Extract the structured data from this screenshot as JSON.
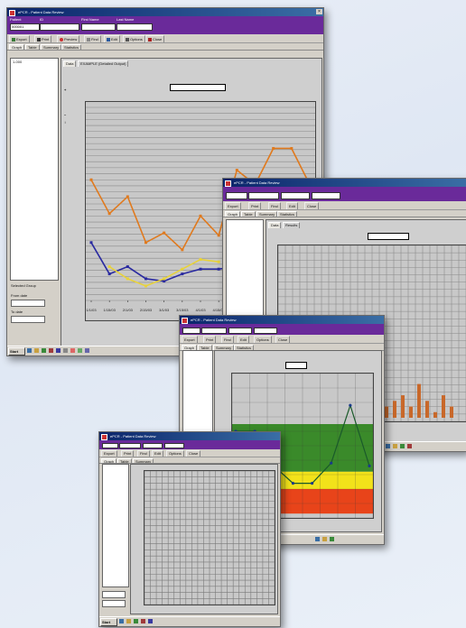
{
  "win1": {
    "title": "ePCR - Patient Data Review",
    "header_labels": [
      "Patient",
      "ID",
      "First Name",
      "Last Name"
    ],
    "patient_id": "000001",
    "toolbar": [
      "Export",
      "Print",
      "Preview",
      "Find",
      "Edit",
      "Options",
      "Close"
    ],
    "tabs": [
      "Graph",
      "Table",
      "Summary",
      "Statistics"
    ],
    "list_item": "1-000",
    "chart_tabs": [
      "Data",
      "EXAMPLE (Detailed Output)"
    ],
    "filters": {
      "section_label": "Selected Group",
      "from_label": "From date",
      "to_label": "To date"
    },
    "chart_data": {
      "type": "line",
      "x": [
        "1/1/03",
        "1/15/03",
        "2/1/03",
        "2/15/03",
        "3/1/03",
        "3/15/03",
        "4/1/03",
        "4/15/03",
        "5/1/03",
        "5/15/03",
        "6/1/03",
        "6/15/03",
        "7/1/03"
      ],
      "series": [
        {
          "color": "#e07a1e",
          "values": [
            120,
            106,
            113,
            94,
            98,
            91,
            105,
            97,
            124,
            118,
            133,
            133,
            118
          ]
        },
        {
          "color": "#2a2aa0",
          "values": [
            94,
            81,
            84,
            79,
            78,
            81,
            83,
            83,
            84,
            84,
            83,
            84,
            84
          ]
        },
        {
          "color": "#e8d23a",
          "values": [
            null,
            84,
            79,
            76,
            79,
            83,
            87,
            86,
            null,
            null,
            null,
            null,
            null
          ]
        }
      ],
      "ylim": [
        70,
        150
      ],
      "grid": true
    }
  },
  "win2": {
    "title": "ePCR - Patient Data Review",
    "toolbar": [
      "Export",
      "Print",
      "Find",
      "Edit",
      "Close"
    ],
    "tabs": [
      "Graph",
      "Table",
      "Summary",
      "Statistics"
    ],
    "chart_tabs": [
      "Data",
      "Results"
    ],
    "chart_data": {
      "type": "bar",
      "color": "#c8682a",
      "values": [
        2,
        3,
        4,
        2,
        6,
        3,
        1,
        4,
        2
      ],
      "ylim": [
        0,
        30
      ],
      "grid": true
    }
  },
  "win3": {
    "title": "ePCR - Patient Data Review",
    "toolbar": [
      "Export",
      "Print",
      "Find",
      "Edit",
      "Options",
      "Close"
    ],
    "tabs": [
      "Graph",
      "Table",
      "Summary",
      "Statistics"
    ],
    "zones": {
      "green": "#3a8a2a",
      "yellow": "#f2e21a",
      "red": "#e8441a"
    },
    "chart_data": {
      "type": "line",
      "values": [
        6.0,
        6.0,
        3.6,
        2.4,
        2.4,
        3.8,
        7.8,
        3.6
      ],
      "ylim": [
        0,
        10
      ],
      "grid": true
    }
  },
  "win4": {
    "title": "ePCR - Patient Data Review",
    "toolbar": [
      "Export",
      "Print",
      "Find",
      "Edit",
      "Options",
      "Close"
    ],
    "tabs": [
      "Graph",
      "Table",
      "Summary"
    ],
    "chart_data": {
      "type": "line",
      "values": [],
      "grid": true
    }
  },
  "taskbar": {
    "start_label": "Start"
  }
}
